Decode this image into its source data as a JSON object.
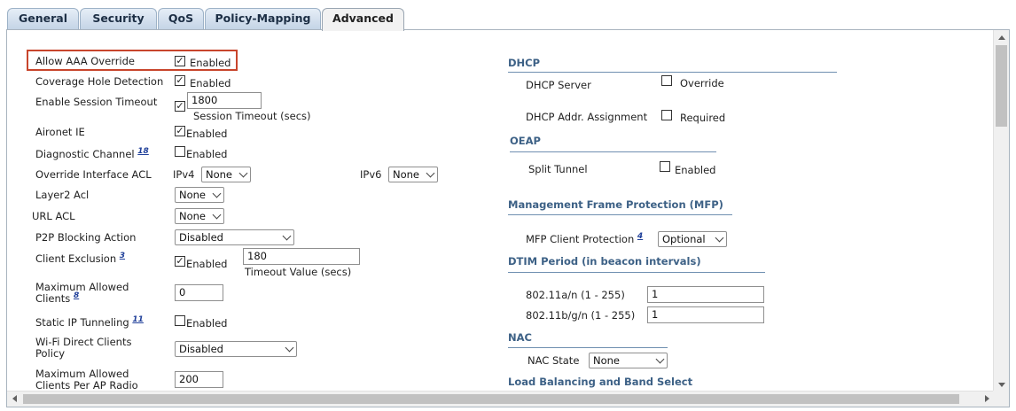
{
  "tabs": [
    "General",
    "Security",
    "QoS",
    "Policy-Mapping",
    "Advanced"
  ],
  "active_tab": "Advanced",
  "left": {
    "allow_aaa_override": {
      "label": "Allow AAA Override",
      "checked": true,
      "text": "Enabled"
    },
    "coverage_hole_detection": {
      "label": "Coverage Hole Detection",
      "checked": true,
      "text": "Enabled"
    },
    "enable_session_timeout": {
      "label": "Enable Session Timeout",
      "checked": true,
      "value": "1800",
      "sublabel": "Session Timeout (secs)"
    },
    "aironet_ie": {
      "label": "Aironet IE",
      "checked": true,
      "text": "Enabled"
    },
    "diagnostic_channel": {
      "label": "Diagnostic Channel",
      "footnote": "18",
      "checked": false,
      "text": "Enabled"
    },
    "override_interface_acl": {
      "label": "Override Interface ACL",
      "ipv4_label": "IPv4",
      "ipv4_value": "None",
      "ipv6_label": "IPv6",
      "ipv6_value": "None"
    },
    "layer2_acl": {
      "label": "Layer2 Acl",
      "value": "None"
    },
    "url_acl": {
      "label": "URL ACL",
      "value": "None"
    },
    "p2p_blocking_action": {
      "label": "P2P Blocking Action",
      "value": "Disabled"
    },
    "client_exclusion": {
      "label": "Client Exclusion",
      "footnote": "3",
      "checked": true,
      "text": "Enabled",
      "value": "180",
      "sublabel": "Timeout Value (secs)"
    },
    "maximum_allowed_clients": {
      "label": "Maximum Allowed Clients",
      "footnote": "8",
      "value": "0"
    },
    "static_ip_tunneling": {
      "label": "Static IP Tunneling",
      "footnote": "11",
      "checked": false,
      "text": "Enabled"
    },
    "wifi_direct_clients_policy": {
      "label": "Wi-Fi Direct Clients Policy",
      "value": "Disabled"
    },
    "maximum_allowed_clients_per_ap_radio": {
      "label": "Maximum Allowed Clients Per AP Radio",
      "value": "200"
    }
  },
  "right": {
    "dhcp": {
      "title": "DHCP",
      "server_label": "DHCP Server",
      "server_checked": false,
      "server_text": "Override",
      "assignment_label": "DHCP Addr. Assignment",
      "assignment_checked": false,
      "assignment_text": "Required"
    },
    "oeap": {
      "title": "OEAP",
      "split_tunnel_label": "Split Tunnel",
      "split_tunnel_checked": false,
      "split_tunnel_text": "Enabled"
    },
    "mfp": {
      "title": "Management Frame Protection (MFP)",
      "client_protection_label": "MFP Client Protection",
      "footnote": "4",
      "client_protection_value": "Optional"
    },
    "dtim": {
      "title": "DTIM Period (in beacon intervals)",
      "a_label": "802.11a/n (1 - 255)",
      "a_value": "1",
      "bg_label": "802.11b/g/n (1 - 255)",
      "bg_value": "1"
    },
    "nac": {
      "title": "NAC",
      "state_label": "NAC State",
      "state_value": "None"
    },
    "load_balancing": {
      "title": "Load Balancing and Band Select"
    }
  },
  "colors": {
    "highlight": "#c8452c",
    "section_title": "#3d6186",
    "tab_gradient_top": "#e6eef7",
    "tab_gradient_bottom": "#c4d4e6"
  },
  "check_glyph": "✓"
}
